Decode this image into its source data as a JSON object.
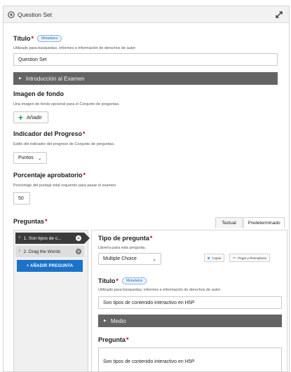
{
  "header": {
    "title": "Question Set"
  },
  "titulo": {
    "label": "Título",
    "required": "*",
    "metadata_badge": "Metadatos",
    "description": "Utilizado para búsquedas, informes e información de derechos de autor",
    "value": "Question Set"
  },
  "intro_accordion": {
    "label": "Introducción al Examen"
  },
  "background": {
    "label": "Imagen de fondo",
    "description": "Una imagen de fondo opcional para el Conjunto de preguntas.",
    "add_label": "Añadir"
  },
  "progress": {
    "label": "Indicador del Progreso",
    "required": "*",
    "description": "Estilo del indicador del progreso de Conjunto de preguntas.",
    "selected": "Puntos"
  },
  "pass_percentage": {
    "label": "Porcentaje aprobatorio",
    "required": "*",
    "description": "Porcentaje del puntaje total requerido para pasar el examen.",
    "value": "50"
  },
  "questions": {
    "label": "Preguntas",
    "required": "*",
    "tabs": [
      "Textual",
      "Predeterminado"
    ],
    "active_tab": 1,
    "items": [
      {
        "label": "1. Son tipos de c..."
      },
      {
        "label": "2. Drag the Words"
      }
    ],
    "add_button": "+ AÑADIR PREGUNTA"
  },
  "question_editor": {
    "type_label": "Tipo de pregunta",
    "required": "*",
    "type_description": "Librería para esta pregunta.",
    "type_selected": "Multiple Choice",
    "copy_label": "Copiar",
    "paste_label": "Pegar y Reemplazar",
    "title_label": "Título",
    "title_metadata": "Metadatos",
    "title_description": "Utilizado para búsquedas, informes e información de derechos de autor",
    "title_value": "Son tipos de contenido interactivo en H5P",
    "media_accordion": "Medio",
    "question_label": "Pregunta",
    "question_value": "Son tipos de contenido interactivo en H5P"
  },
  "colors": {
    "accent_blue": "#1a73c9",
    "accordion_gray": "#646464",
    "required_red": "#d0021b",
    "add_green": "#1e9c4a",
    "active_item": "#3b3b3b",
    "inactive_item": "#dedede"
  }
}
